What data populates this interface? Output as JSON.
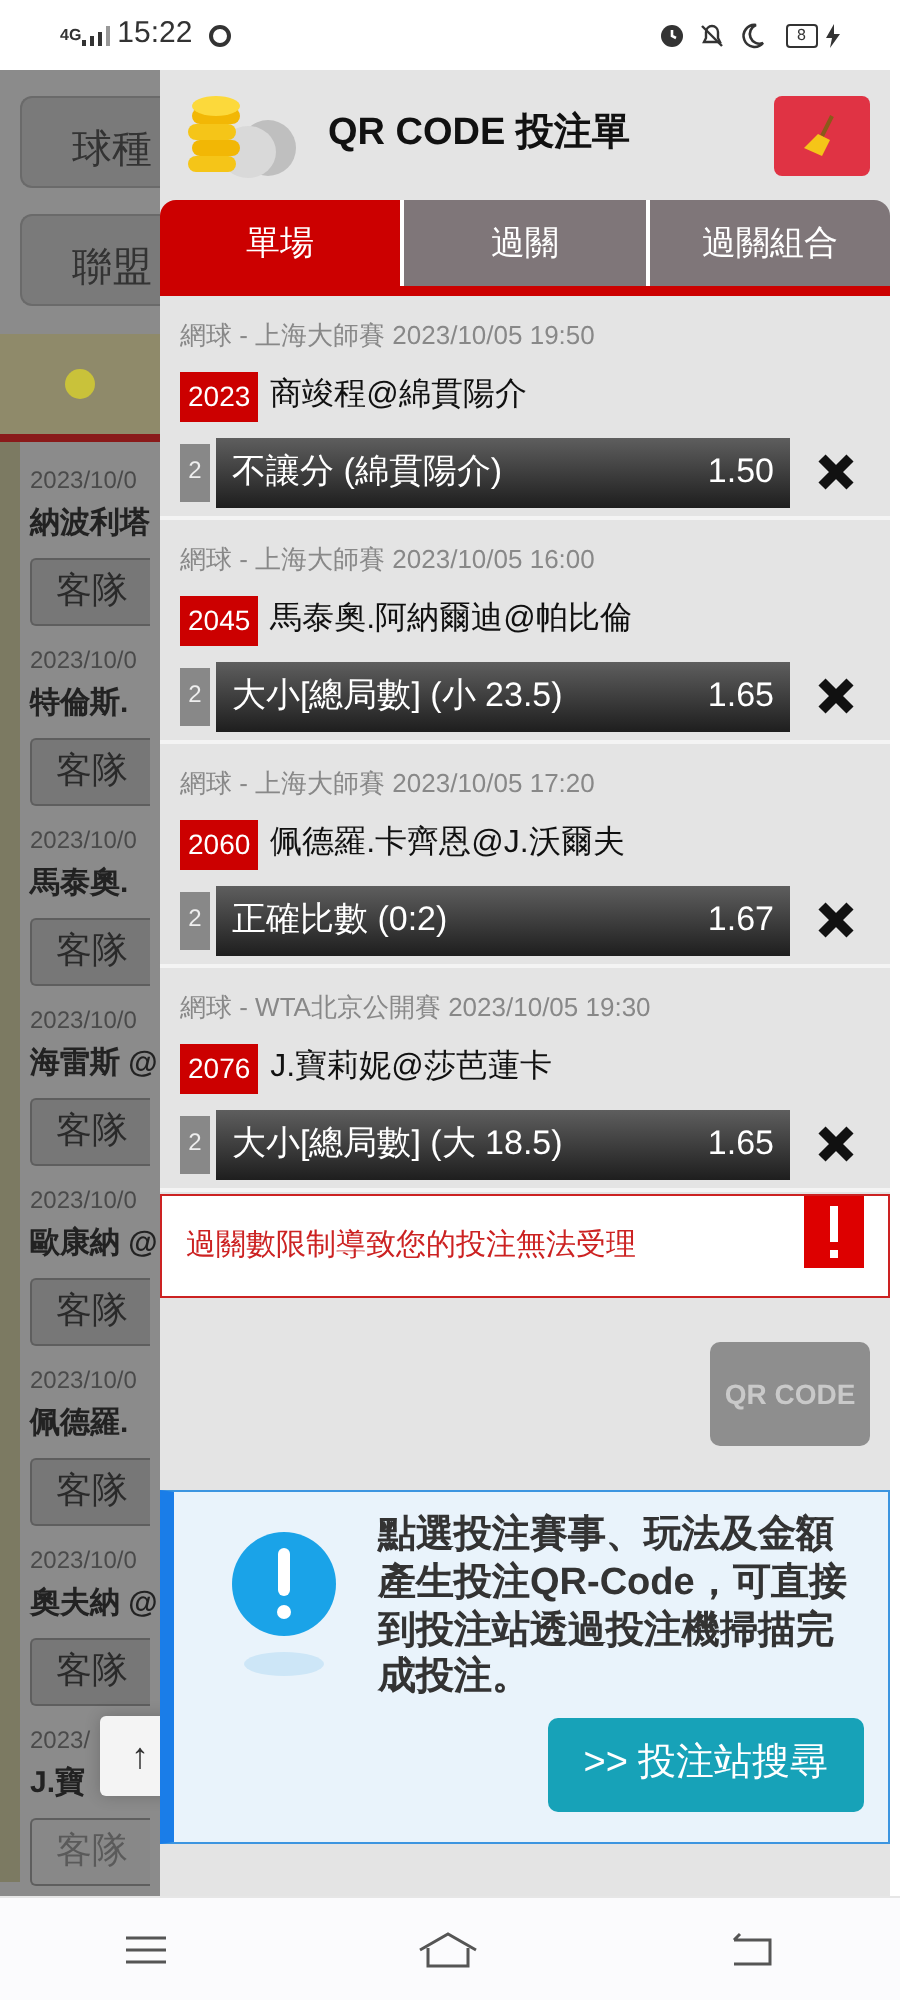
{
  "status_bar": {
    "network": "4G",
    "time": "15:22",
    "battery": "8"
  },
  "background_page": {
    "filters": [
      "球種",
      "聯盟"
    ],
    "rows": [
      {
        "date": "2023/10/0",
        "match": "納波利塔",
        "button": "客隊",
        "disabled": false
      },
      {
        "date": "2023/10/0",
        "match": "特倫斯.",
        "button": "客隊",
        "disabled": false
      },
      {
        "date": "2023/10/0",
        "match": "馬泰奧.",
        "button": "客隊",
        "disabled": false
      },
      {
        "date": "2023/10/0",
        "match": "海雷斯 @",
        "button": "客隊",
        "disabled": false
      },
      {
        "date": "2023/10/0",
        "match": "歐康納 @",
        "button": "客隊",
        "disabled": false
      },
      {
        "date": "2023/10/0",
        "match": "佩德羅.",
        "button": "客隊",
        "disabled": false
      },
      {
        "date": "2023/10/0",
        "match": "奧夫納 @",
        "button": "客隊",
        "disabled": false
      },
      {
        "date": "2023/",
        "match": "J.寶",
        "button": "客隊",
        "disabled": true
      }
    ],
    "scroll_top": "↑"
  },
  "bet_slip": {
    "title": "QR CODE 投注單",
    "tabs": [
      {
        "label": "單場",
        "selected": true
      },
      {
        "label": "過關",
        "selected": false
      },
      {
        "label": "過關組合",
        "selected": false
      }
    ],
    "bets": [
      {
        "event": "網球 - 上海大師賽 2023/10/05 19:50",
        "code": "2023",
        "match": "商竣程@綿貫陽介",
        "count": "2",
        "selection": "不讓分 (綿貫陽介)",
        "odds": "1.50"
      },
      {
        "event": "網球 - 上海大師賽 2023/10/05 16:00",
        "code": "2045",
        "match": "馬泰奧.阿納爾迪@帕比倫",
        "count": "2",
        "selection": "大小[總局數] (小 23.5)",
        "odds": "1.65"
      },
      {
        "event": "網球 - 上海大師賽 2023/10/05 17:20",
        "code": "2060",
        "match": "佩德羅.卡齊恩@J.沃爾夫",
        "count": "2",
        "selection": "正確比數 (0:2)",
        "odds": "1.67"
      },
      {
        "event": "網球 - WTA北京公開賽 2023/10/05 19:30",
        "code": "2076",
        "match": "J.寶莉妮@莎芭蓮卡",
        "count": "2",
        "selection": "大小[總局數] (大 18.5)",
        "odds": "1.65"
      }
    ],
    "error": "過關數限制導致您的投注無法受理",
    "qr_button": {
      "label": "QR CODE",
      "disabled": true
    },
    "info": {
      "text": "點選投注賽事、玩法及金額產生投注QR-Code，可直接到投注站透過投注機掃描完成投注。",
      "button": ">> 投注站搜尋"
    }
  }
}
